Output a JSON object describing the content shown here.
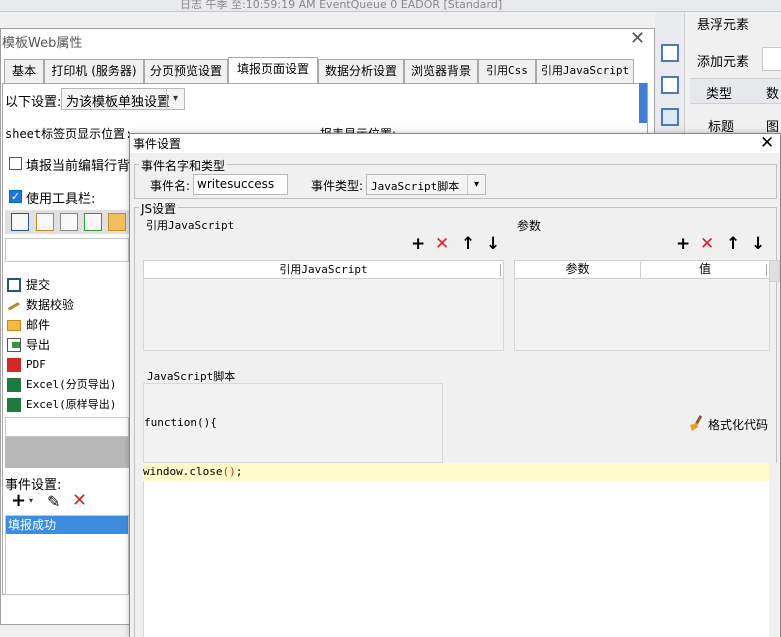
{
  "top_toolbar": {
    "path_text": "日志 午季 至:10:59:19 AM EventQueue 0 EADOR [Standard]"
  },
  "right_dock": {
    "title": "悬浮元素",
    "add_element_label": "添加元素",
    "col_type": "类型",
    "col_num": "数",
    "row_title": "标题",
    "row_pic": "图"
  },
  "props_window": {
    "title": "模板Web属性",
    "close": "✕",
    "tabs": [
      "基本",
      "打印机 (服务器)",
      "分页预览设置",
      "填报页面设置",
      "数据分析设置",
      "浏览器背景",
      "引用Css",
      "引用JavaScript"
    ],
    "active_tab": 3,
    "below_settings_label": "以下设置:",
    "scope_select_value": "为该模板单独设置",
    "sheet_label": "sheet标签页显示位置:",
    "report_pos_label": "报表显示位置:",
    "fill_highlight_label": "填报当前编辑行背景",
    "use_toolbar_label": "使用工具栏:",
    "toolbar_items": [
      {
        "icon": "save-icon",
        "label": "提交"
      },
      {
        "icon": "pencil-icon",
        "label": "数据校验"
      },
      {
        "icon": "mail-icon",
        "label": "邮件"
      },
      {
        "icon": "export-icon",
        "label": "导出"
      },
      {
        "icon": "pdf-icon",
        "label": "PDF"
      },
      {
        "icon": "excel-icon",
        "label": "Excel(分页导出)"
      },
      {
        "icon": "excel-icon",
        "label": "Excel(原样导出)"
      }
    ],
    "event_settings_label": "事件设置:",
    "event_list": [
      "填报成功"
    ]
  },
  "dialog": {
    "title": "事件设置",
    "close": "✕",
    "group_name_type": "事件名字和类型",
    "event_name_label": "事件名:",
    "event_name_value": "writesuccess",
    "event_type_label": "事件类型:",
    "event_type_value": "JavaScript脚本",
    "group_js": "JS设置",
    "ref_js_label": "引用JavaScript",
    "params_label": "参数",
    "ref_js_header": "引用JavaScript",
    "params_header_name": "参数",
    "params_header_value": "值",
    "js_script_label": "JavaScript脚本",
    "code_line1": "function(){",
    "code_line2_main": "window.close",
    "code_line2_paren": "()",
    "code_line2_end": ";",
    "format_code_label": "格式化代码"
  },
  "colors": {
    "accent": "#3c8ce0",
    "delete": "#e02020",
    "highlight_line": "#fffbc8"
  }
}
